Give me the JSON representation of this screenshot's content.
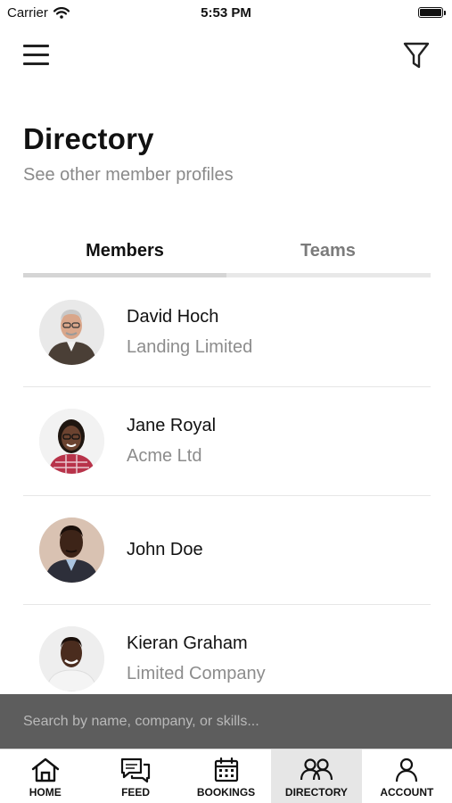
{
  "status_bar": {
    "carrier": "Carrier",
    "time": "5:53 PM"
  },
  "header": {
    "menu_icon": "hamburger-menu-icon",
    "filter_icon": "filter-funnel-icon"
  },
  "page": {
    "title": "Directory",
    "subtitle": "See other member profiles"
  },
  "tabs": [
    {
      "label": "Members",
      "active": true
    },
    {
      "label": "Teams",
      "active": false
    }
  ],
  "members": [
    {
      "name": "David Hoch",
      "company": "Landing Limited"
    },
    {
      "name": "Jane Royal",
      "company": "Acme Ltd"
    },
    {
      "name": "John Doe",
      "company": ""
    },
    {
      "name": "Kieran Graham",
      "company": "Limited Company"
    }
  ],
  "search": {
    "placeholder": "Search by name, company, or skills..."
  },
  "tab_bar": [
    {
      "label": "HOME",
      "icon": "home-icon",
      "active": false
    },
    {
      "label": "FEED",
      "icon": "chat-bubbles-icon",
      "active": false
    },
    {
      "label": "BOOKINGS",
      "icon": "calendar-icon",
      "active": false
    },
    {
      "label": "DIRECTORY",
      "icon": "people-icon",
      "active": true
    },
    {
      "label": "ACCOUNT",
      "icon": "person-icon",
      "active": false
    }
  ]
}
